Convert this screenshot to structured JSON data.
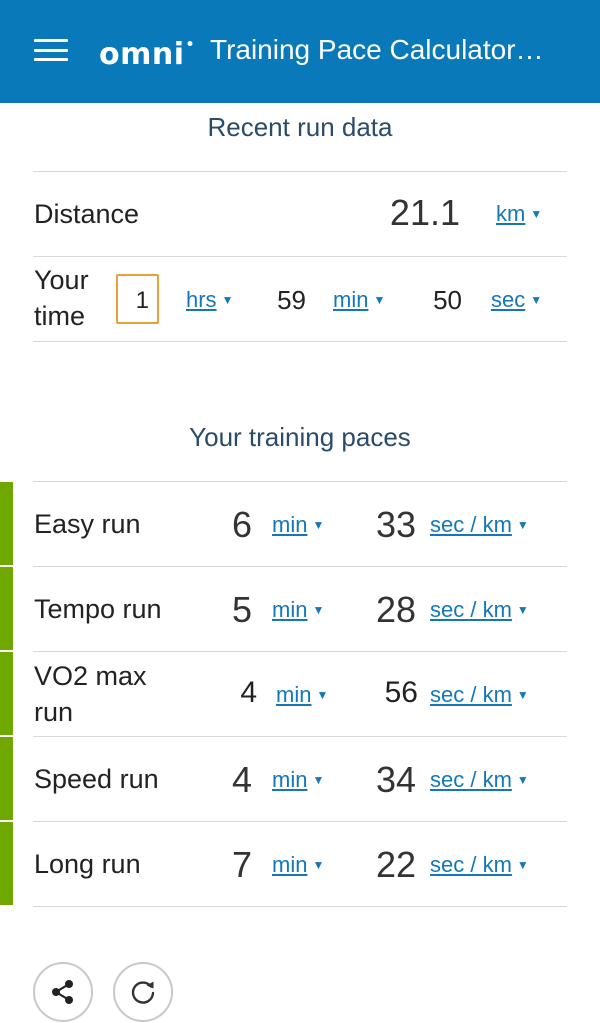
{
  "header": {
    "logo": "omni",
    "logo_mark": "•",
    "title": "Training Pace Calculator…"
  },
  "recent": {
    "heading": "Recent run data",
    "distance_label": "Distance",
    "distance_value": "21.1",
    "distance_unit": "km",
    "time_label_line1": "Your",
    "time_label_line2": "time",
    "hours": "1",
    "hours_unit": "hrs",
    "minutes": "59",
    "minutes_unit": "min",
    "seconds": "50",
    "seconds_unit": "sec"
  },
  "paces": {
    "heading": "Your training paces",
    "rows": [
      {
        "label_line1": "Easy run",
        "label_line2": "",
        "min": "6",
        "min_unit": "min",
        "sec": "33",
        "sec_unit": "sec / km"
      },
      {
        "label_line1": "Tempo run",
        "label_line2": "",
        "min": "5",
        "min_unit": "min",
        "sec": "28",
        "sec_unit": "sec / km"
      },
      {
        "label_line1": "VO2 max",
        "label_line2": "run",
        "min": "4",
        "min_unit": "min",
        "sec": "56",
        "sec_unit": "sec / km"
      },
      {
        "label_line1": "Speed run",
        "label_line2": "",
        "min": "4",
        "min_unit": "min",
        "sec": "34",
        "sec_unit": "sec / km"
      },
      {
        "label_line1": "Long run",
        "label_line2": "",
        "min": "7",
        "min_unit": "min",
        "sec": "22",
        "sec_unit": "sec / km"
      }
    ]
  },
  "actions": {
    "share_icon": "share-icon",
    "reload_icon": "reload-icon"
  },
  "colors": {
    "header_bg": "#0a79b9",
    "link": "#1478b8",
    "accent_green": "#6ea800",
    "input_border": "#e6a13a"
  }
}
